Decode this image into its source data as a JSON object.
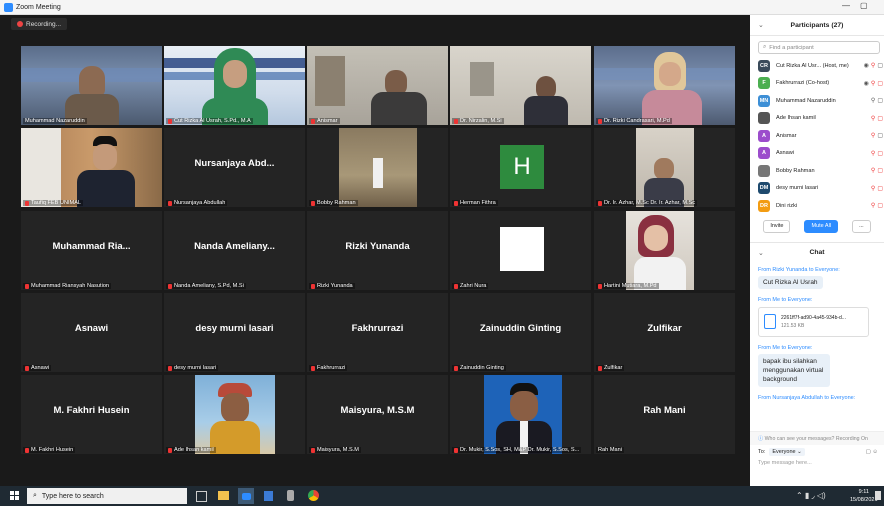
{
  "window": {
    "title": "Zoom Meeting",
    "minimize": "—",
    "restore": "▢"
  },
  "recording": {
    "label": "Recording..."
  },
  "grid": {
    "r1": [
      {
        "label": "Muhammad Nazaruddin"
      },
      {
        "label": "Cut Rizka Al Usrah, S.Pd., M.A"
      },
      {
        "label": "Anismar"
      },
      {
        "label": "Dr. Nirzalin, M.Si"
      },
      {
        "label": "Dr. Rizki Candrasari, M.Pd"
      }
    ],
    "r2": [
      {
        "label": "Taufiq FEB UNIMAL"
      },
      {
        "name": "Nursanjaya Abd...",
        "label": "Nursanjaya Abdullah"
      },
      {
        "label": "Bobby Rahman"
      },
      {
        "initial": "H",
        "label": "Herman Fithra"
      },
      {
        "label": "Dr. Ir. Azhar, M.Sc Dr. Ir. Azhar, M.Sc"
      }
    ],
    "r3": [
      {
        "name": "Muhammad Ria...",
        "label": "Muhammad Riansyah Nasution"
      },
      {
        "name": "Nanda Ameliany...",
        "label": "Nanda Ameliany, S.Pd, M.Si"
      },
      {
        "name": "Rizki Yunanda",
        "label": "Rizki Yunanda"
      },
      {
        "label": "Zahri Nura"
      },
      {
        "label": "Hartini Mutiara, M.Pd"
      }
    ],
    "r4": [
      {
        "name": "Asnawi",
        "label": "Asnawi"
      },
      {
        "name": "desy murni lasari",
        "label": "desy murni lasari"
      },
      {
        "name": "Fakhrurrazi",
        "label": "Fakhrurrazi"
      },
      {
        "name": "Zainuddin Ginting",
        "label": "Zainuddin Ginting"
      },
      {
        "name": "Zulfikar",
        "label": "Zulfikar"
      }
    ],
    "r5": [
      {
        "name": "M. Fakhri Husein",
        "label": "M. Fakhri Husein"
      },
      {
        "label": "Ade Ihsan kamil"
      },
      {
        "name": "Maisyura, M.S.M",
        "label": "Maisyura, M.S.M"
      },
      {
        "label": "Dr. Mukir, S.Sos, SH, M&P Dr. Mukir, S.Sos, S..."
      },
      {
        "name": "Rah Mani",
        "label": "Rah Mani"
      }
    ]
  },
  "participants": {
    "title": "Participants (27)",
    "search_placeholder": "Find a participant",
    "list": [
      {
        "initials": "CR",
        "color": "#3a4a5a",
        "name": "Cut Rizka Al Usr...  (Host, me)"
      },
      {
        "initials": "F",
        "color": "#4caf50",
        "name": "Fakhrurrazi (Co-host)"
      },
      {
        "initials": "MN",
        "color": "#3d8fd6",
        "name": "Muhammad Nazaruddin"
      },
      {
        "initials": "",
        "color": "#555555",
        "name": "Ade Ihsan kamil"
      },
      {
        "initials": "A",
        "color": "#9c4dcc",
        "name": "Anismar"
      },
      {
        "initials": "A",
        "color": "#9c4dcc",
        "name": "Asnawi"
      },
      {
        "initials": "",
        "color": "#777777",
        "name": "Bobby Rahman"
      },
      {
        "initials": "DM",
        "color": "#1e4a6e",
        "name": "desy murni lasari"
      },
      {
        "initials": "DR",
        "color": "#f39c12",
        "name": "Dini rizki"
      }
    ],
    "invite": "Invite",
    "mute_all": "Mute All",
    "more": "..."
  },
  "chat": {
    "title": "Chat",
    "messages": {
      "m1_from": "From Rizki Yunanda to Everyone:",
      "m1_text": "Cut Rizka Al Usrah",
      "m2_from": "From Me to Everyone:",
      "m2_file": "2261ff7f-ad90-4a45-934b-d...",
      "m2_size": "121.53 KB",
      "m3_from": "From Me to Everyone:",
      "m3_text": "bapak ibu silahkan menggunakan virtual background",
      "m4_from": "From Nursanjaya Abdullah to Everyone:"
    },
    "notice": "Who can see your messages? Recording On",
    "to_label": "To:",
    "to_value": "Everyone",
    "input_placeholder": "Type message here..."
  },
  "taskbar": {
    "search_placeholder": "Type here to search",
    "time": "9:11",
    "date": "15/08/2021"
  }
}
